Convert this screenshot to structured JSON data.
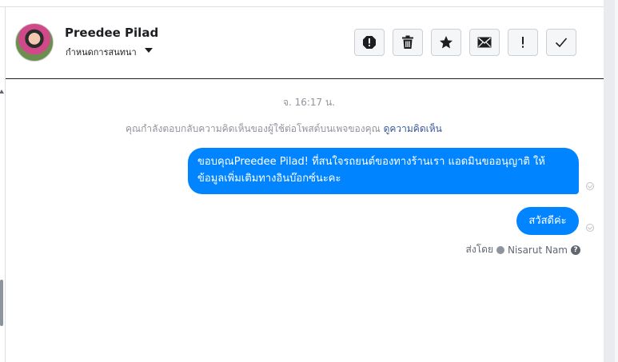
{
  "header": {
    "contact_name": "Preedee Pilad",
    "assign_label": "กำหนดการสนทนา",
    "avatar_icon": "profile-photo",
    "toolbar": [
      {
        "icon": "spam-icon",
        "label": "Mark as spam"
      },
      {
        "icon": "trash-icon",
        "label": "Delete"
      },
      {
        "icon": "star-icon",
        "label": "Star"
      },
      {
        "icon": "envelope-icon",
        "label": "Mark as unread"
      },
      {
        "icon": "exclamation-icon",
        "label": "Follow up"
      },
      {
        "icon": "check-icon",
        "label": "Mark as done"
      }
    ]
  },
  "conversation": {
    "timestamp": "จ. 16:17 น.",
    "notice_text": "คุณกำลังตอบกลับความคิดเห็นของผู้ใช้ต่อโพสต์บนเพจของคุณ",
    "notice_link": "ดูความคิดเห็น",
    "messages": [
      {
        "text": "ขอบคุณPreedee Pilad! ที่สนใจรถยนต์ของทางร้านเรา แอดมินขออนุญาติ ให้ข้อมูลเพิ่มเติมทางอินบ๊อกซ์นะคะ",
        "status_icon": "seen-check-icon"
      },
      {
        "text": "สวัสดีค่ะ",
        "status_icon": "seen-check-icon"
      }
    ],
    "sent_by_label": "ส่งโดย",
    "sent_by_name": "Nisarut Nam"
  },
  "colors": {
    "bubble": "#0084ff",
    "muted_text": "#90949c",
    "link": "#385898",
    "button_bg": "#f5f6f7",
    "button_border": "#ccd0d5"
  }
}
